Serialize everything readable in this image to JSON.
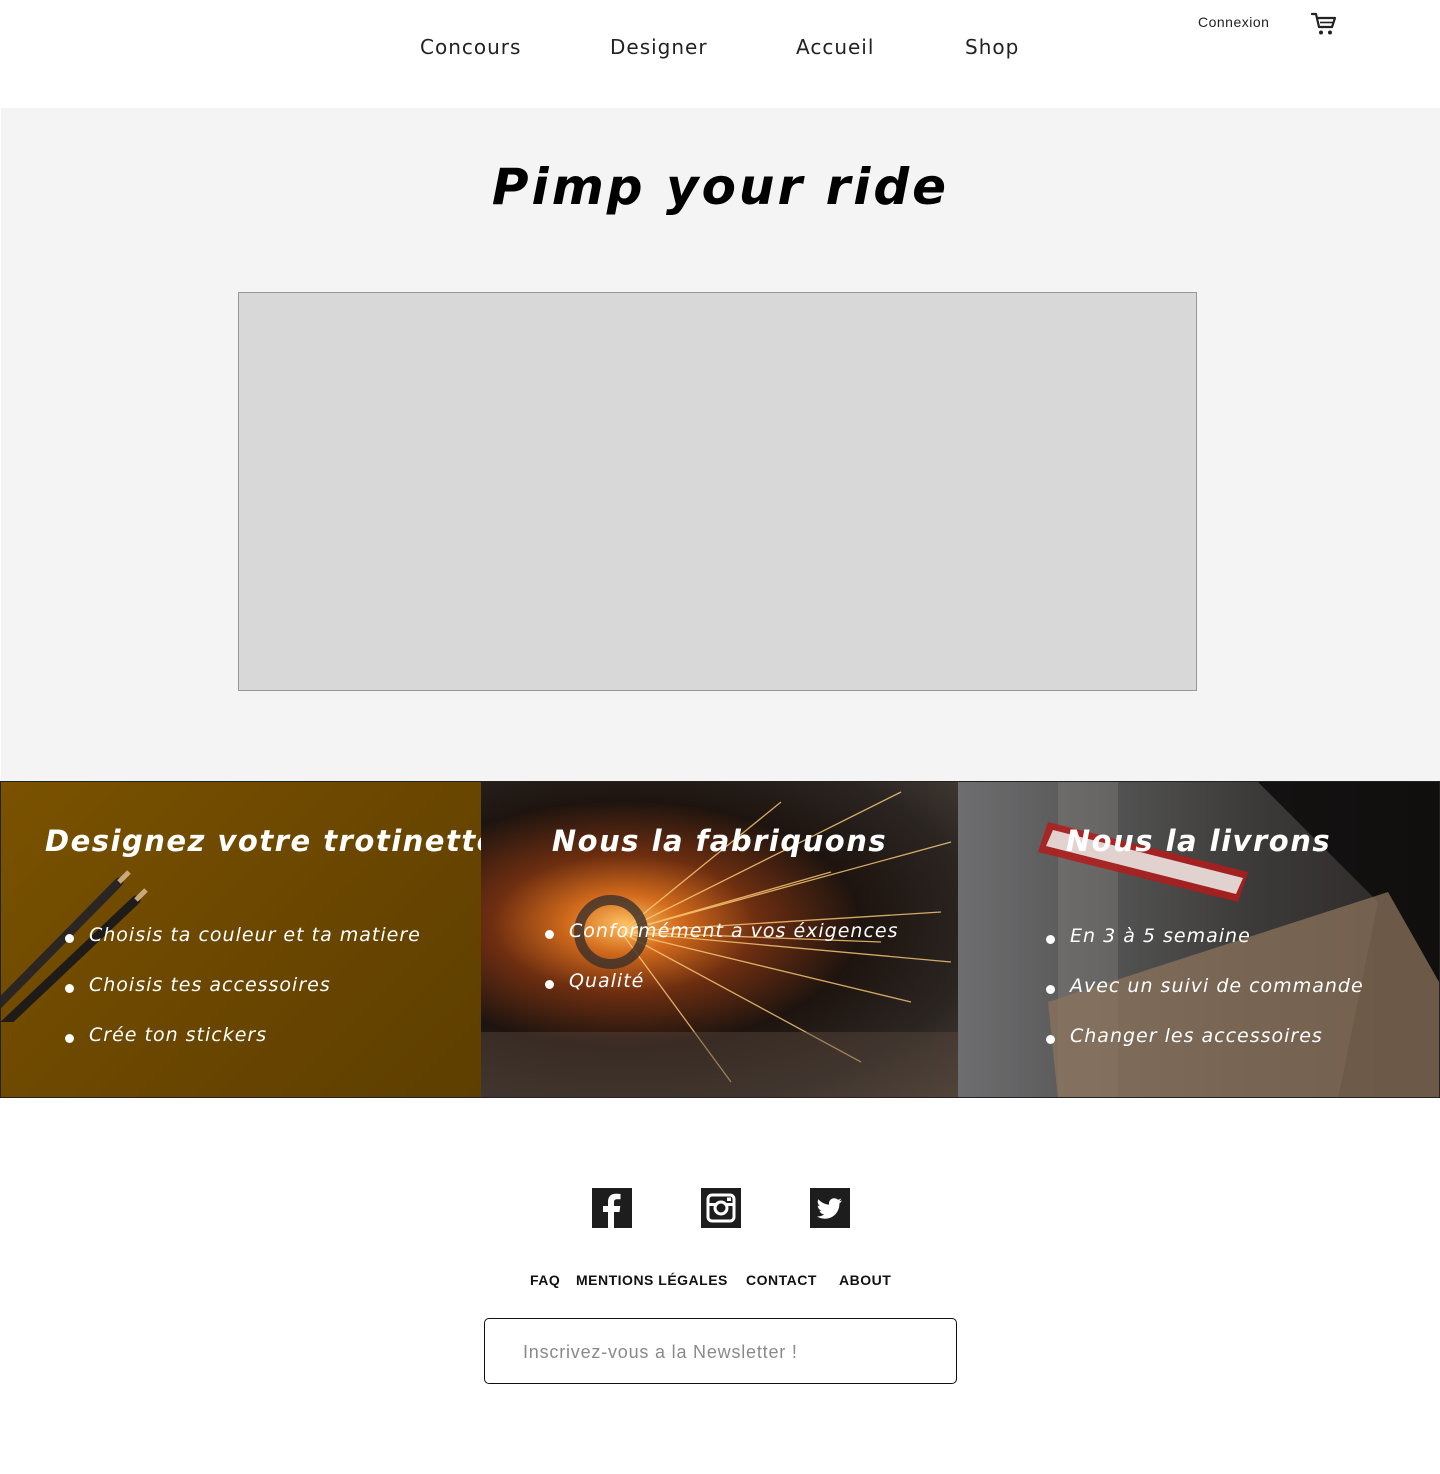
{
  "header": {
    "nav": [
      {
        "label": "Concours"
      },
      {
        "label": "Designer"
      },
      {
        "label": "Accueil"
      },
      {
        "label": "Shop"
      }
    ],
    "login_label": "Connexion",
    "cart_icon": "shopping-cart-icon"
  },
  "hero": {
    "title": "Pimp your ride"
  },
  "features": [
    {
      "title": "Designez votre trotinette",
      "bullets": [
        "Choisis ta couleur et ta matiere",
        "Choisis tes accessoires",
        "Crée ton stickers"
      ]
    },
    {
      "title": "Nous la fabriquons",
      "bullets": [
        "Conformément a vos éxigences",
        "Qualité"
      ]
    },
    {
      "title": "Nous la livrons",
      "bullets": [
        "En 3 à 5 semaine",
        "Avec un suivi de commande",
        "Changer les accessoires"
      ]
    }
  ],
  "footer": {
    "social_icons": [
      "facebook-icon",
      "instagram-icon",
      "twitter-icon"
    ],
    "links": [
      {
        "label": "FAQ"
      },
      {
        "label": "MENTIONS LÉGALES"
      },
      {
        "label": "CONTACT"
      },
      {
        "label": "ABOUT"
      }
    ],
    "newsletter_placeholder": "Inscrivez-vous a la Newsletter !"
  }
}
